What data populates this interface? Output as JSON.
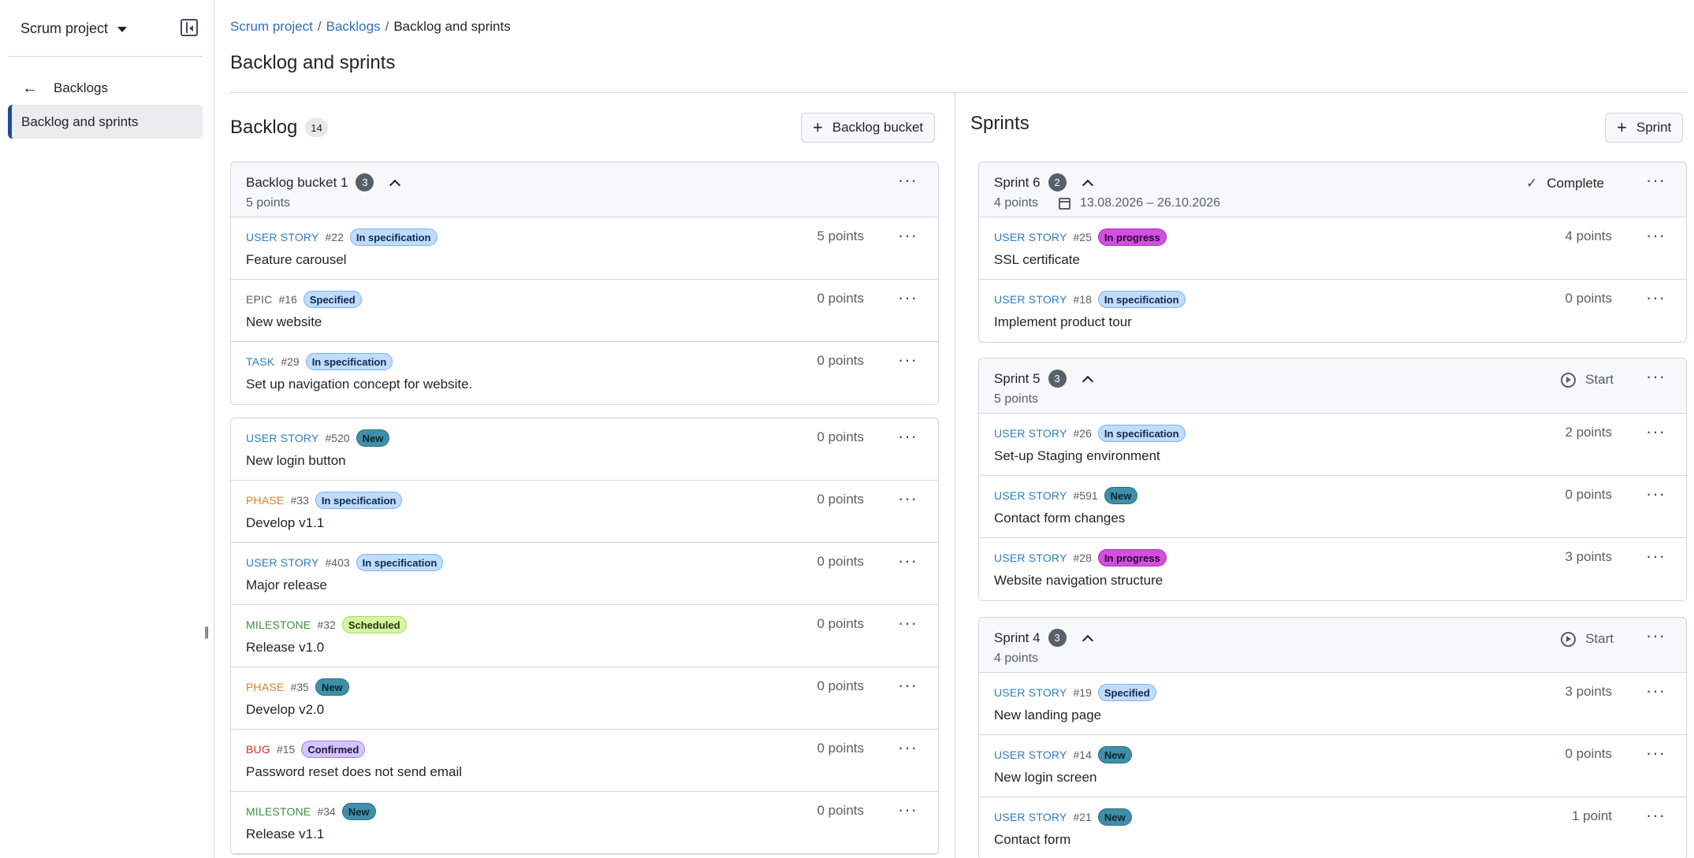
{
  "sidebar": {
    "project_name": "Scrum project",
    "back_label": "Backlogs",
    "active_item": "Backlog and sprints"
  },
  "breadcrumb": [
    "Scrum project",
    "Backlogs",
    "Backlog and sprints"
  ],
  "page_title": "Backlog and sprints",
  "backlog": {
    "title": "Backlog",
    "count": "14",
    "add_button": "Backlog bucket",
    "bucket": {
      "title": "Backlog bucket 1",
      "count": "3",
      "points": "5 points",
      "items": [
        {
          "type": "USER STORY",
          "type_class": "t-story",
          "num": "#22",
          "status": "In specification",
          "status_class": "s-spec",
          "title": "Feature carousel",
          "points": "5 points"
        },
        {
          "type": "EPIC",
          "type_class": "t-epic",
          "num": "#16",
          "status": "Specified",
          "status_class": "s-specified",
          "title": "New website",
          "points": "0 points"
        },
        {
          "type": "TASK",
          "type_class": "t-task",
          "num": "#29",
          "status": "In specification",
          "status_class": "s-spec",
          "title": "Set up navigation concept for website.",
          "points": "0 points"
        }
      ]
    },
    "items": [
      {
        "type": "USER STORY",
        "type_class": "t-story",
        "num": "#520",
        "status": "New",
        "status_class": "s-new",
        "title": "New login button",
        "points": "0 points"
      },
      {
        "type": "PHASE",
        "type_class": "t-phase",
        "num": "#33",
        "status": "In specification",
        "status_class": "s-spec",
        "title": "Develop v1.1",
        "points": "0 points"
      },
      {
        "type": "USER STORY",
        "type_class": "t-story",
        "num": "#403",
        "status": "In specification",
        "status_class": "s-spec",
        "title": "Major release",
        "points": "0 points"
      },
      {
        "type": "MILESTONE",
        "type_class": "t-milestone",
        "num": "#32",
        "status": "Scheduled",
        "status_class": "s-scheduled",
        "title": "Release v1.0",
        "points": "0 points"
      },
      {
        "type": "PHASE",
        "type_class": "t-phase",
        "num": "#35",
        "status": "New",
        "status_class": "s-new",
        "title": "Develop v2.0",
        "points": "0 points"
      },
      {
        "type": "BUG",
        "type_class": "t-bug",
        "num": "#15",
        "status": "Confirmed",
        "status_class": "s-confirmed",
        "title": "Password reset does not send email",
        "points": "0 points"
      },
      {
        "type": "MILESTONE",
        "type_class": "t-milestone",
        "num": "#34",
        "status": "New",
        "status_class": "s-new",
        "title": "Release v1.1",
        "points": "0 points"
      }
    ]
  },
  "sprints": {
    "title": "Sprints",
    "add_button": "Sprint",
    "list": [
      {
        "title": "Sprint 6",
        "count": "2",
        "points": "4 points",
        "dates": "13.08.2026 – 26.10.2026",
        "action": "Complete",
        "action_icon": "check-icon",
        "items": [
          {
            "type": "USER STORY",
            "type_class": "t-story",
            "num": "#25",
            "status": "In progress",
            "status_class": "s-progress",
            "title": "SSL certificate",
            "points": "4 points"
          },
          {
            "type": "USER STORY",
            "type_class": "t-story",
            "num": "#18",
            "status": "In specification",
            "status_class": "s-spec",
            "title": "Implement product tour",
            "points": "0 points"
          }
        ]
      },
      {
        "title": "Sprint 5",
        "count": "3",
        "points": "5 points",
        "dates": "",
        "action": "Start",
        "action_icon": "play-circle-icon",
        "items": [
          {
            "type": "USER STORY",
            "type_class": "t-story",
            "num": "#26",
            "status": "In specification",
            "status_class": "s-spec",
            "title": "Set-up Staging environment",
            "points": "2 points"
          },
          {
            "type": "USER STORY",
            "type_class": "t-story",
            "num": "#591",
            "status": "New",
            "status_class": "s-new",
            "title": "Contact form changes",
            "points": "0 points"
          },
          {
            "type": "USER STORY",
            "type_class": "t-story",
            "num": "#28",
            "status": "In progress",
            "status_class": "s-progress",
            "title": "Website navigation structure",
            "points": "3 points"
          }
        ]
      },
      {
        "title": "Sprint 4",
        "count": "3",
        "points": "4 points",
        "dates": "",
        "action": "Start",
        "action_icon": "play-circle-icon",
        "items": [
          {
            "type": "USER STORY",
            "type_class": "t-story",
            "num": "#19",
            "status": "Specified",
            "status_class": "s-specified",
            "title": "New landing page",
            "points": "3 points"
          },
          {
            "type": "USER STORY",
            "type_class": "t-story",
            "num": "#14",
            "status": "New",
            "status_class": "s-new",
            "title": "New login screen",
            "points": "0 points"
          },
          {
            "type": "USER STORY",
            "type_class": "t-story",
            "num": "#21",
            "status": "New",
            "status_class": "s-new",
            "title": "Contact form",
            "points": "1 point"
          }
        ]
      }
    ]
  }
}
